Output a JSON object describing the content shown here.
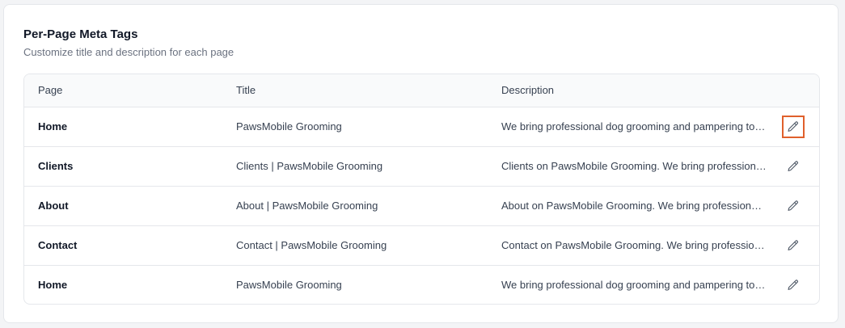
{
  "section": {
    "title": "Per-Page Meta Tags",
    "subtitle": "Customize title and description for each page"
  },
  "table": {
    "columns": [
      "Page",
      "Title",
      "Description",
      ""
    ],
    "rows": [
      {
        "page": "Home",
        "title": "PawsMobile Grooming",
        "description": "We bring professional dog grooming and pampering to your door",
        "focused": true
      },
      {
        "page": "Clients",
        "title": "Clients | PawsMobile Grooming",
        "description": "Clients on PawsMobile Grooming. We bring professional dog grooming",
        "focused": false
      },
      {
        "page": "About",
        "title": "About | PawsMobile Grooming",
        "description": "About on PawsMobile Grooming. We bring professional dog grooming",
        "focused": false
      },
      {
        "page": "Contact",
        "title": "Contact | PawsMobile Grooming",
        "description": "Contact on PawsMobile Grooming. We bring professional dog grooming",
        "focused": false
      },
      {
        "page": "Home",
        "title": "PawsMobile Grooming",
        "description": "We bring professional dog grooming and pampering to your door",
        "focused": false
      }
    ],
    "action_icon": "pencil-icon"
  },
  "colors": {
    "focus_ring": "#e0602c",
    "header_bg": "#f9fafb",
    "border": "#e5e7eb"
  }
}
